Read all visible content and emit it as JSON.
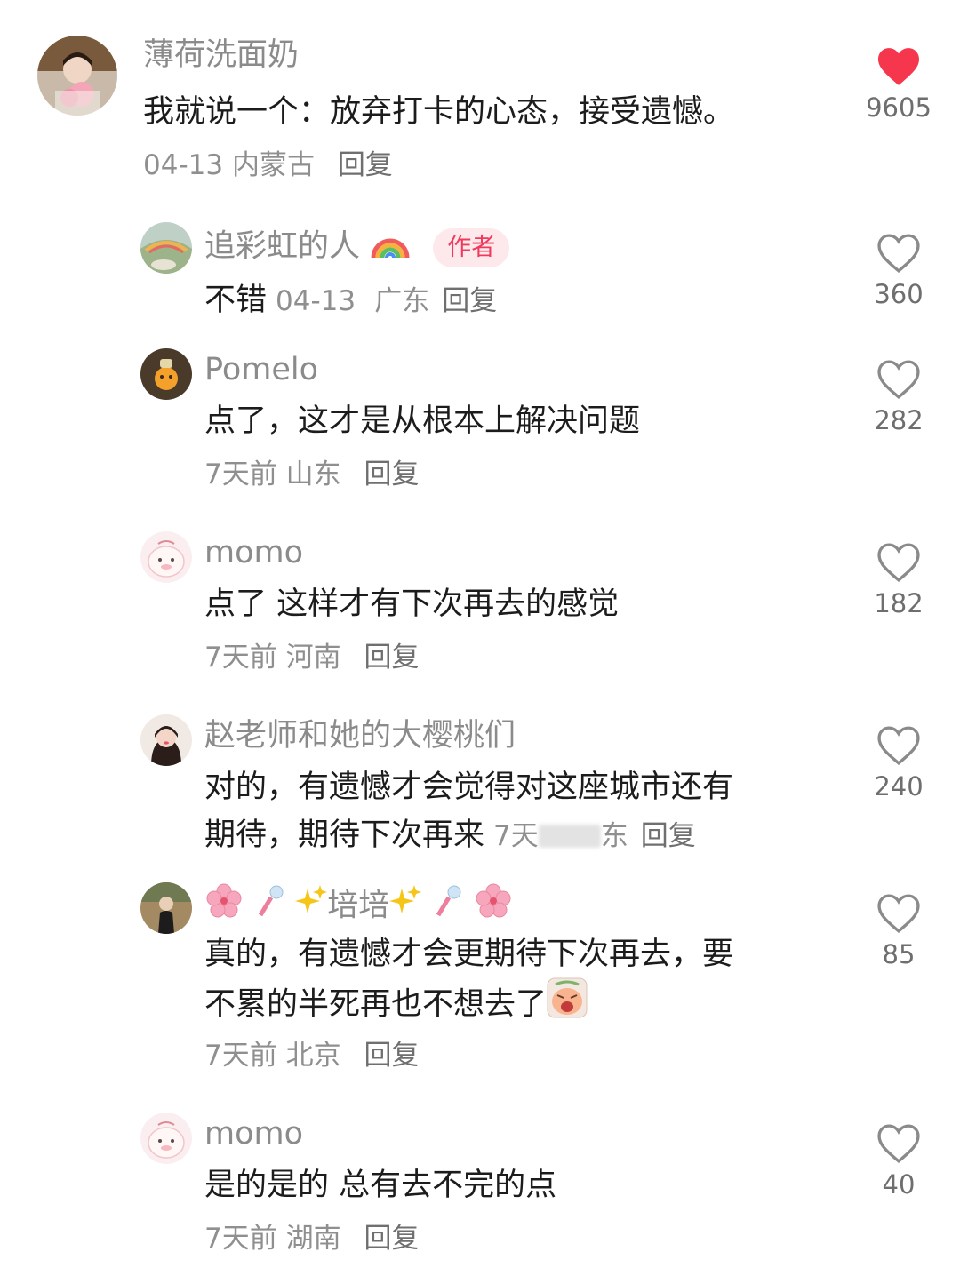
{
  "comments": [
    {
      "username": "薄荷洗面奶",
      "text": "我就说一个：放弃打卡的心态，接受遗憾。",
      "date": "04-13",
      "location": "内蒙古",
      "reply": "回复",
      "likes": "9605",
      "liked": true
    },
    {
      "username": "追彩虹的人",
      "badge": "作者",
      "text": "不错",
      "date": "04-13",
      "location": "广东",
      "reply": "回复",
      "likes": "360"
    },
    {
      "username": "Pomelo",
      "text": "点了，这才是从根本上解决问题",
      "date": "7天前",
      "location": "山东",
      "reply": "回复",
      "likes": "282"
    },
    {
      "username": "momo",
      "text": "点了 这样才有下次再去的感觉",
      "date": "7天前",
      "location": "河南",
      "reply": "回复",
      "likes": "182"
    },
    {
      "username": "赵老师和她的大樱桃们",
      "text_line1": "对的，有遗憾才会觉得对这座城市还有",
      "text_line2": "期待，期待下次再来",
      "date_partial": "7天",
      "location_partial": "东",
      "reply": "回复",
      "likes": "240"
    },
    {
      "username": "培培",
      "text_line1": "真的，有遗憾才会更期待下次再去，要",
      "text_line2": "不累的半死再也不想去了",
      "date": "7天前",
      "location": "北京",
      "reply": "回复",
      "likes": "85"
    },
    {
      "username": "momo",
      "text": "是的是的 总有去不完的点",
      "date": "7天前",
      "location": "湖南",
      "reply": "回复",
      "likes": "40"
    }
  ],
  "colors": {
    "liked_heart": "#f5364c",
    "heart_outline": "#8a8a8a",
    "author_badge_bg": "#fde9ec",
    "author_badge_text": "#ef3a5d"
  }
}
